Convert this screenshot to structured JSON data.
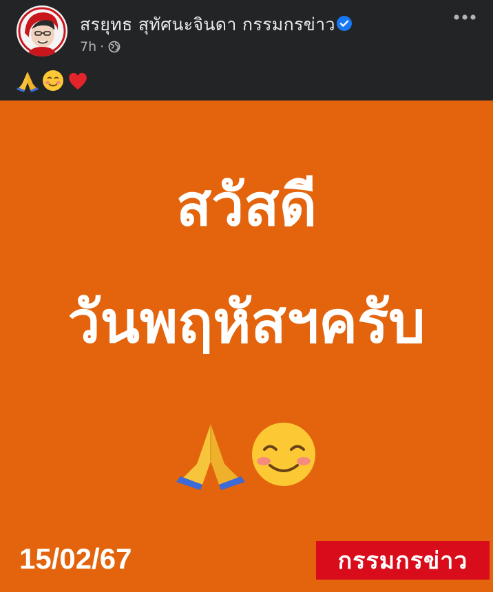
{
  "post": {
    "author": "สรยุทธ สุทัศนะจินดา กรรมกรข่าว",
    "time": "7h",
    "separator": "·",
    "audience_icon": "globe-icon",
    "verified_icon": "verified-badge-icon",
    "more_icon": "more-options-icon",
    "caption_emojis": [
      "folded-hands-emoji",
      "smiling-face-emoji",
      "red-heart-emoji"
    ]
  },
  "image": {
    "headline_line1": "สวัสดี",
    "headline_line2": "วันพฤหัสฯครับ",
    "emojis": [
      "folded-hands-emoji",
      "smiling-face-emoji"
    ],
    "date": "15/02/67",
    "brand": "กรรมกรข่าว"
  },
  "colors": {
    "header_bg": "#232426",
    "image_bg": "#e3640c",
    "brand_bg": "#d80c1b",
    "verified": "#1877f2",
    "text": "#ffffff"
  }
}
